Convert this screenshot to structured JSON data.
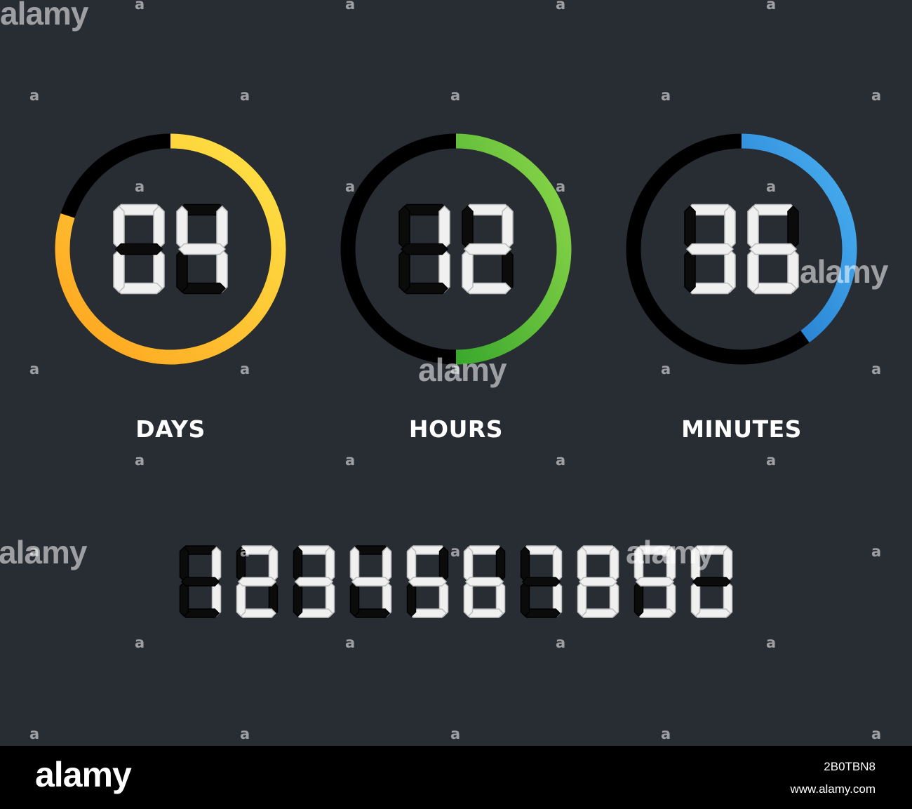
{
  "timers": [
    {
      "unit_label": "DAYS",
      "value": "04",
      "progress": 0.8,
      "color_start": "#ffa31f",
      "color_end": "#fde547"
    },
    {
      "unit_label": "HOURS",
      "value": "12",
      "progress": 0.5,
      "color_start": "#3aa82d",
      "color_end": "#8fd84a"
    },
    {
      "unit_label": "MINUTES",
      "value": "36",
      "progress": 0.4,
      "color_start": "#1d74c9",
      "color_end": "#4cb2f2"
    }
  ],
  "digit_row": "1234567890",
  "colors": {
    "background": "#282c33",
    "segment_on": "#f0f0f0",
    "segment_off": "#0b0b0b",
    "ring_track": "#000000",
    "footer": "#000000"
  },
  "watermark": {
    "glyph": "a",
    "word": "alamy"
  },
  "footer": {
    "logo": "alamy",
    "image_code": "2B0TBN8",
    "url": "www.alamy.com"
  }
}
